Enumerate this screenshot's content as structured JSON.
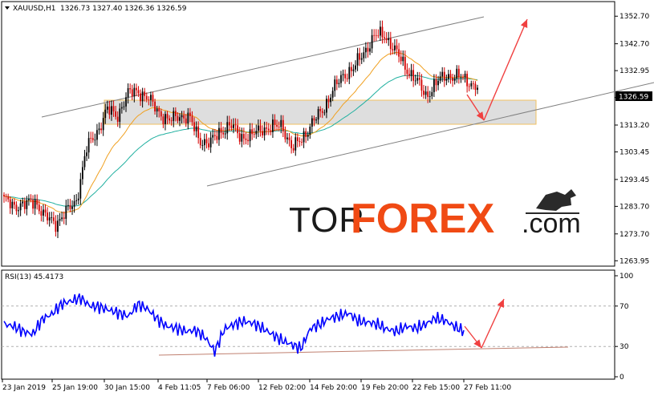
{
  "header": {
    "symbol": "XAUUSD,H1",
    "ohlc": "1326.73 1327.40 1326.36 1326.59"
  },
  "price_badge": "1326.59",
  "rsi_header": "RSI(13) 45.4173",
  "watermark": {
    "tor": "TOR",
    "forex": "FOREX",
    "com": ".com"
  },
  "colors": {
    "bull_candle": "#000000",
    "bear_candle": "#d40000",
    "ma_fast": "#f0a020",
    "ma_slow": "#20b0a0",
    "channel": "#808080",
    "zone_fill": "#d8d8d8",
    "zone_border": "#f0c060",
    "forecast_arrow": "#f04040",
    "rsi_line": "#0000ff",
    "rsi_support": "#c08070",
    "logo_accent": "#f04a14"
  },
  "chart_data": [
    {
      "type": "line",
      "title": "",
      "series": [
        {
          "name": "XAUUSD H1",
          "y": [
            1285.5,
            1284.3,
            1283.8,
            1286.1,
            1279.5,
            1277.8,
            1281.2,
            1285.6,
            1304.2,
            1310.6,
            1318.5,
            1316.8,
            1324.1,
            1326.0,
            1322.3,
            1318.6,
            1314.1,
            1317.2,
            1315.4,
            1308.2,
            1306.1,
            1311.3,
            1312.8,
            1309.4,
            1308.7,
            1312.4,
            1311.6,
            1313.8,
            1303.9,
            1309.2,
            1313.7,
            1319.4,
            1325.7,
            1331.9,
            1333.5,
            1340.2,
            1345.2,
            1346.3,
            1339.8,
            1334.6,
            1329.3,
            1324.1,
            1328.2,
            1331.6,
            1330.5,
            1329.7,
            1326.6
          ]
        }
      ],
      "x_ticks": [
        "23 Jan 2019",
        "25 Jan 19:00",
        "30 Jan 15:00",
        "4 Feb 11:05",
        "7 Feb 06:00",
        "12 Feb 02:00",
        "14 Feb 20:00",
        "19 Feb 20:00",
        "22 Feb 15:00",
        "27 Feb 11:00"
      ],
      "y_ticks": [
        1352.7,
        1342.7,
        1332.95,
        1323.2,
        1313.2,
        1303.45,
        1293.45,
        1283.7,
        1273.7,
        1263.95
      ],
      "ylim": [
        1262.0,
        1358.0
      ]
    },
    {
      "type": "line",
      "title": "",
      "series": [
        {
          "name": "RSI(13)",
          "y": [
            52,
            50,
            45,
            42,
            57,
            62,
            72,
            75,
            78,
            70,
            69,
            66,
            63,
            60,
            72,
            67,
            57,
            50,
            48,
            45,
            46,
            39,
            25,
            47,
            52,
            55,
            53,
            48,
            42,
            36,
            32,
            28,
            48,
            52,
            58,
            60,
            63,
            55,
            54,
            52,
            47,
            45,
            50,
            48,
            52,
            58,
            56,
            50,
            45
          ]
        }
      ],
      "y_ticks": [
        100,
        70,
        30,
        0
      ],
      "ylim": [
        0,
        100
      ]
    }
  ]
}
